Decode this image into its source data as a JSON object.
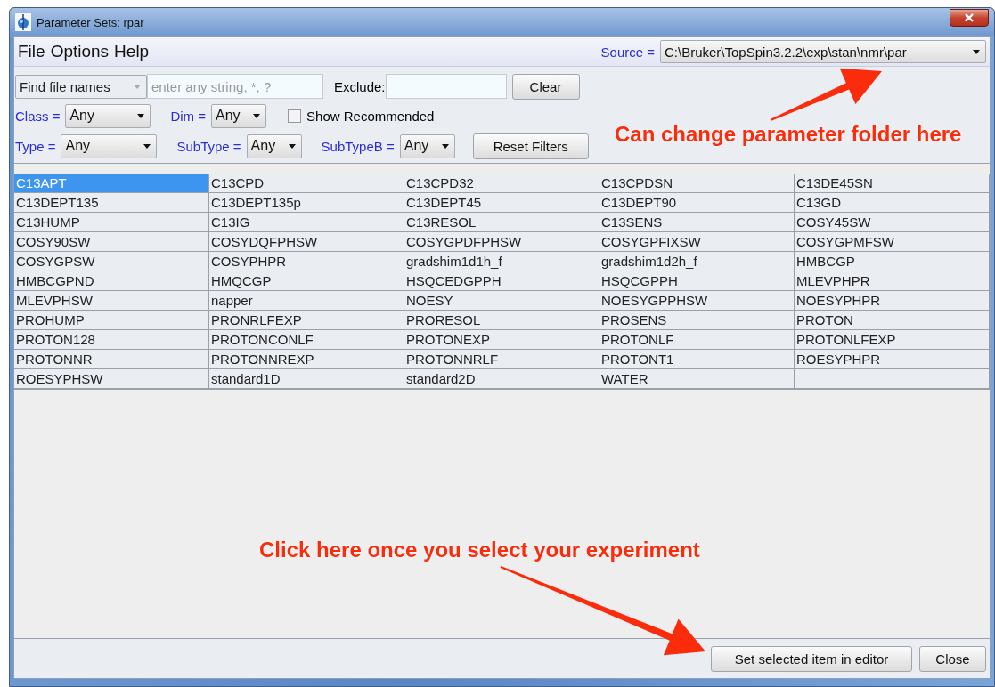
{
  "window": {
    "title": "Parameter Sets: rpar"
  },
  "menu": [
    "File",
    "Options",
    "Help"
  ],
  "source": {
    "label": "Source =",
    "value": "C:\\Bruker\\TopSpin3.2.2\\exp\\stan\\nmr\\par"
  },
  "search": {
    "mode": "Find file names",
    "placeholder": "enter any string, *, ?",
    "exclude_label": "Exclude:",
    "clear": "Clear"
  },
  "filters_row1": [
    {
      "label": "Class =",
      "value": "Any"
    },
    {
      "label": "Dim =",
      "value": "Any"
    }
  ],
  "show_recommended": {
    "label": "Show Recommended",
    "checked": false
  },
  "filters_row2": [
    {
      "label": "Type =",
      "value": "Any"
    },
    {
      "label": "SubType =",
      "value": "Any"
    },
    {
      "label": "SubTypeB =",
      "value": "Any"
    }
  ],
  "reset": "Reset Filters",
  "items": [
    {
      "name": "C13APT",
      "selected": true
    },
    {
      "name": "C13CPD",
      "selected": false
    },
    {
      "name": "C13CPD32",
      "selected": false
    },
    {
      "name": "C13CPDSN",
      "selected": false
    },
    {
      "name": "C13DE45SN",
      "selected": false
    },
    {
      "name": "C13DEPT135",
      "selected": false
    },
    {
      "name": "C13DEPT135p",
      "selected": false
    },
    {
      "name": "C13DEPT45",
      "selected": false
    },
    {
      "name": "C13DEPT90",
      "selected": false
    },
    {
      "name": "C13GD",
      "selected": false
    },
    {
      "name": "C13HUMP",
      "selected": false
    },
    {
      "name": "C13IG",
      "selected": false
    },
    {
      "name": "C13RESOL",
      "selected": false
    },
    {
      "name": "C13SENS",
      "selected": false
    },
    {
      "name": "COSY45SW",
      "selected": false
    },
    {
      "name": "COSY90SW",
      "selected": false
    },
    {
      "name": "COSYDQFPHSW",
      "selected": false
    },
    {
      "name": "COSYGPDFPHSW",
      "selected": false
    },
    {
      "name": "COSYGPFIXSW",
      "selected": false
    },
    {
      "name": "COSYGPMFSW",
      "selected": false
    },
    {
      "name": "COSYGPSW",
      "selected": false
    },
    {
      "name": "COSYPHPR",
      "selected": false
    },
    {
      "name": "gradshim1d1h_f",
      "selected": false
    },
    {
      "name": "gradshim1d2h_f",
      "selected": false
    },
    {
      "name": "HMBCGP",
      "selected": false
    },
    {
      "name": "HMBCGPND",
      "selected": false
    },
    {
      "name": "HMQCGP",
      "selected": false
    },
    {
      "name": "HSQCEDGPPH",
      "selected": false
    },
    {
      "name": "HSQCGPPH",
      "selected": false
    },
    {
      "name": "MLEVPHPR",
      "selected": false
    },
    {
      "name": "MLEVPHSW",
      "selected": false
    },
    {
      "name": "napper",
      "selected": false
    },
    {
      "name": "NOESY",
      "selected": false
    },
    {
      "name": "NOESYGPPHSW",
      "selected": false
    },
    {
      "name": "NOESYPHPR",
      "selected": false
    },
    {
      "name": "PROHUMP",
      "selected": false
    },
    {
      "name": "PRONRLFEXP",
      "selected": false
    },
    {
      "name": "PRORESOL",
      "selected": false
    },
    {
      "name": "PROSENS",
      "selected": false
    },
    {
      "name": "PROTON",
      "selected": false
    },
    {
      "name": "PROTON128",
      "selected": false
    },
    {
      "name": "PROTONCONLF",
      "selected": false
    },
    {
      "name": "PROTONEXP",
      "selected": false
    },
    {
      "name": "PROTONLF",
      "selected": false
    },
    {
      "name": "PROTONLFEXP",
      "selected": false
    },
    {
      "name": "PROTONNR",
      "selected": false
    },
    {
      "name": "PROTONNREXP",
      "selected": false
    },
    {
      "name": "PROTONNRLF",
      "selected": false
    },
    {
      "name": "PROTONT1",
      "selected": false
    },
    {
      "name": "ROESYPHPR",
      "selected": false
    },
    {
      "name": "ROESYPHSW",
      "selected": false
    },
    {
      "name": "standard1D",
      "selected": false
    },
    {
      "name": "standard2D",
      "selected": false
    },
    {
      "name": "WATER",
      "selected": false
    }
  ],
  "buttons": [
    "Set selected item in editor",
    "Close"
  ],
  "annotations": [
    "Can change parameter folder here",
    "Click here once you select your experiment"
  ]
}
